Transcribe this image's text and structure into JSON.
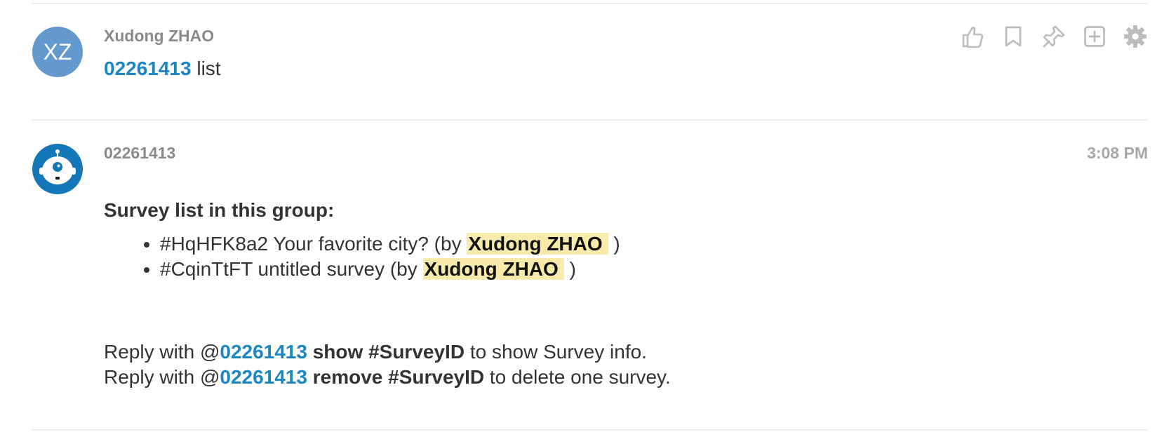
{
  "message1": {
    "avatar_initials": "XZ",
    "sender": "Xudong ZHAO",
    "mention": "02261413",
    "text": " list"
  },
  "message2": {
    "sender": "02261413",
    "timestamp": "3:08 PM",
    "heading": "Survey list in this group:",
    "surveys": [
      {
        "id": "#HqHFK8a2",
        "title": "  Your favorite city? (by ",
        "author": "Xudong ZHAO",
        "suffix": " )"
      },
      {
        "id": "#CqinTtFT",
        "title": " untitled survey (by ",
        "author": "Xudong ZHAO",
        "suffix": " )"
      }
    ],
    "reply_lines": [
      {
        "prefix": "Reply with @",
        "mention": "02261413",
        "command": " show #SurveyID",
        "suffix": " to show Survey info."
      },
      {
        "prefix": "Reply with @",
        "mention": "02261413",
        "command": " remove #SurveyID",
        "suffix": " to delete one survey."
      }
    ]
  },
  "actions": [
    {
      "icon": "thumbs-up-icon",
      "label": "Like"
    },
    {
      "icon": "bookmark-icon",
      "label": "Bookmark"
    },
    {
      "icon": "pin-icon",
      "label": "Pin"
    },
    {
      "icon": "add-box-icon",
      "label": "Add"
    },
    {
      "icon": "gear-icon",
      "label": "Settings"
    }
  ],
  "colors": {
    "accent": "#1a86c3",
    "highlight": "#f8eaaa",
    "avatar_xz": "#6399cf",
    "avatar_bot": "#1478b8",
    "muted": "#8a8a8a"
  }
}
